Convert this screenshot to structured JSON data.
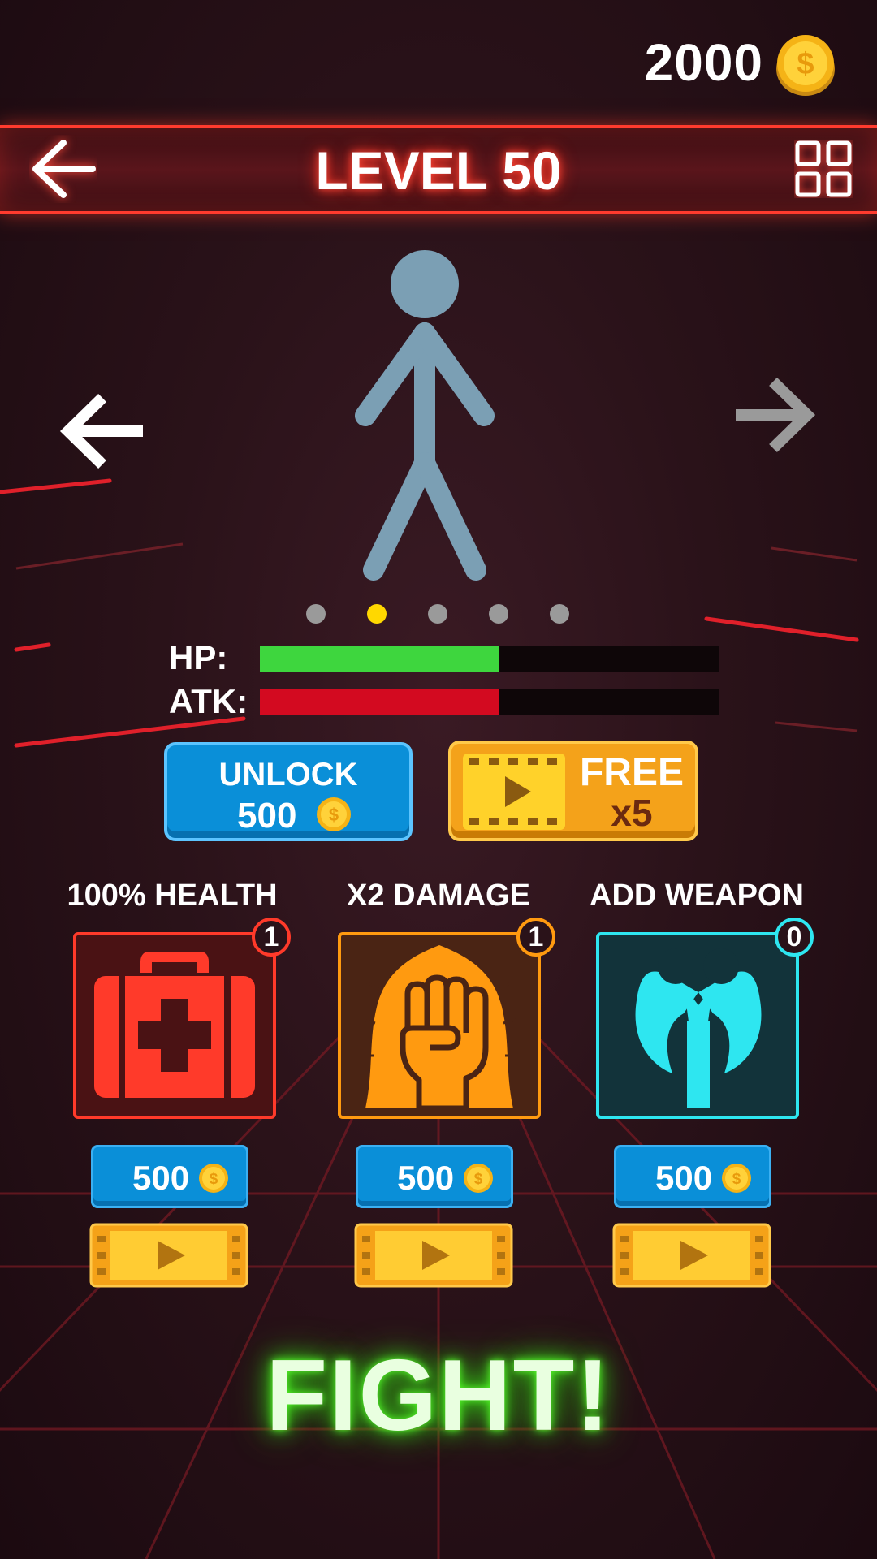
{
  "coins": {
    "amount": "2000",
    "icon": "coin-icon"
  },
  "header": {
    "title": "LEVEL 50",
    "back_icon": "back-arrow-icon",
    "menu_icon": "grid-menu-icon",
    "accent": "#ff3b2e"
  },
  "character": {
    "prev_icon": "arrow-left-icon",
    "next_icon": "arrow-right-icon",
    "figure_color": "#7b9fb4",
    "pages": 5,
    "active_page": 2
  },
  "stats": {
    "hp": {
      "label": "HP:",
      "level": 0.52,
      "color": "#3ed63e"
    },
    "atk": {
      "label": "ATK:",
      "level": 0.52,
      "color": "#d30a20"
    }
  },
  "actions": {
    "unlock": {
      "label": "UNLOCK",
      "price": "500"
    },
    "free": {
      "label": "FREE",
      "multiplier": "x5"
    }
  },
  "powerups": [
    {
      "label": "100% HEALTH",
      "count": "1",
      "price": "500",
      "icon": "first-aid-kit-icon",
      "color": "#ff3a2a"
    },
    {
      "label": "X2 DAMAGE",
      "count": "1",
      "price": "500",
      "icon": "raised-fist-icon",
      "color": "#ff9a10"
    },
    {
      "label": "ADD WEAPON",
      "count": "0",
      "price": "500",
      "icon": "battle-axe-icon",
      "color": "#2ee6f0"
    }
  ],
  "fight": {
    "label": "FIGHT!"
  }
}
